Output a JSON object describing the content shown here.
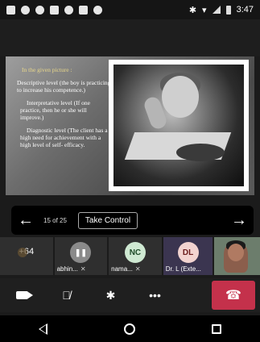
{
  "status_bar": {
    "time": "3:47",
    "left_icons": [
      "teams-icon",
      "facebook-icon",
      "messenger-icon",
      "phone-icon",
      "whatsapp-icon",
      "youtube-icon",
      "chat-icon"
    ],
    "right_icons": [
      "bluetooth-icon",
      "wifi-icon",
      "signal-icon",
      "battery-icon"
    ]
  },
  "slide": {
    "heading": "In the given picture :",
    "paragraphs": [
      "Descriptive level (the boy  is practicing to increase his competence.)",
      "Interpretative level (If one  practice, then he or she will  improve.)",
      "Diagnostic level (The client has a high need for achievement with a high level of self- efficacy."
    ]
  },
  "presentation_nav": {
    "page_indicator": "15 of 25",
    "take_control_label": "Take Control",
    "prev_icon": "←",
    "next_icon": "→"
  },
  "participants": [
    {
      "kind": "overflow",
      "label": "+64"
    },
    {
      "kind": "paused",
      "name": "abhin..."
    },
    {
      "kind": "initials",
      "initials": "NC",
      "name": "nama..."
    },
    {
      "kind": "initials",
      "initials": "DL",
      "name": "Dr. L (Exte..."
    },
    {
      "kind": "video"
    }
  ],
  "controls": [
    "camera-icon",
    "mic-off-icon",
    "bluetooth-icon",
    "more-icon",
    "hang-up-icon"
  ],
  "colors": {
    "hangup": "#c4314b",
    "slide_heading": "#e8d78a"
  }
}
